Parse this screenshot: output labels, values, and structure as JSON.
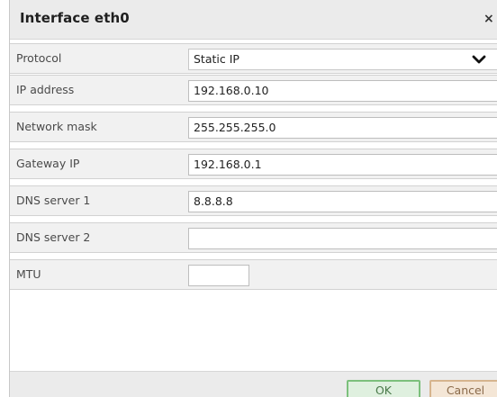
{
  "dialog": {
    "title": "Interface eth0",
    "close_label": "×"
  },
  "fields": {
    "protocol": {
      "label": "Protocol",
      "value": "Static IP"
    },
    "ip_address": {
      "label": "IP address",
      "value": "192.168.0.10"
    },
    "network_mask": {
      "label": "Network mask",
      "value": "255.255.255.0"
    },
    "gateway_ip": {
      "label": "Gateway IP",
      "value": "192.168.0.1"
    },
    "dns1": {
      "label": "DNS server 1",
      "value": "8.8.8.8"
    },
    "dns2": {
      "label": "DNS server 2",
      "value": ""
    },
    "mtu": {
      "label": "MTU",
      "value": ""
    }
  },
  "buttons": {
    "ok": "OK",
    "cancel": "Cancel"
  },
  "icons": {
    "close": "close-icon",
    "dropdown": "chevron-down-icon"
  },
  "colors": {
    "ok_border": "#7cc07c",
    "cancel_border": "#d6b48e"
  }
}
